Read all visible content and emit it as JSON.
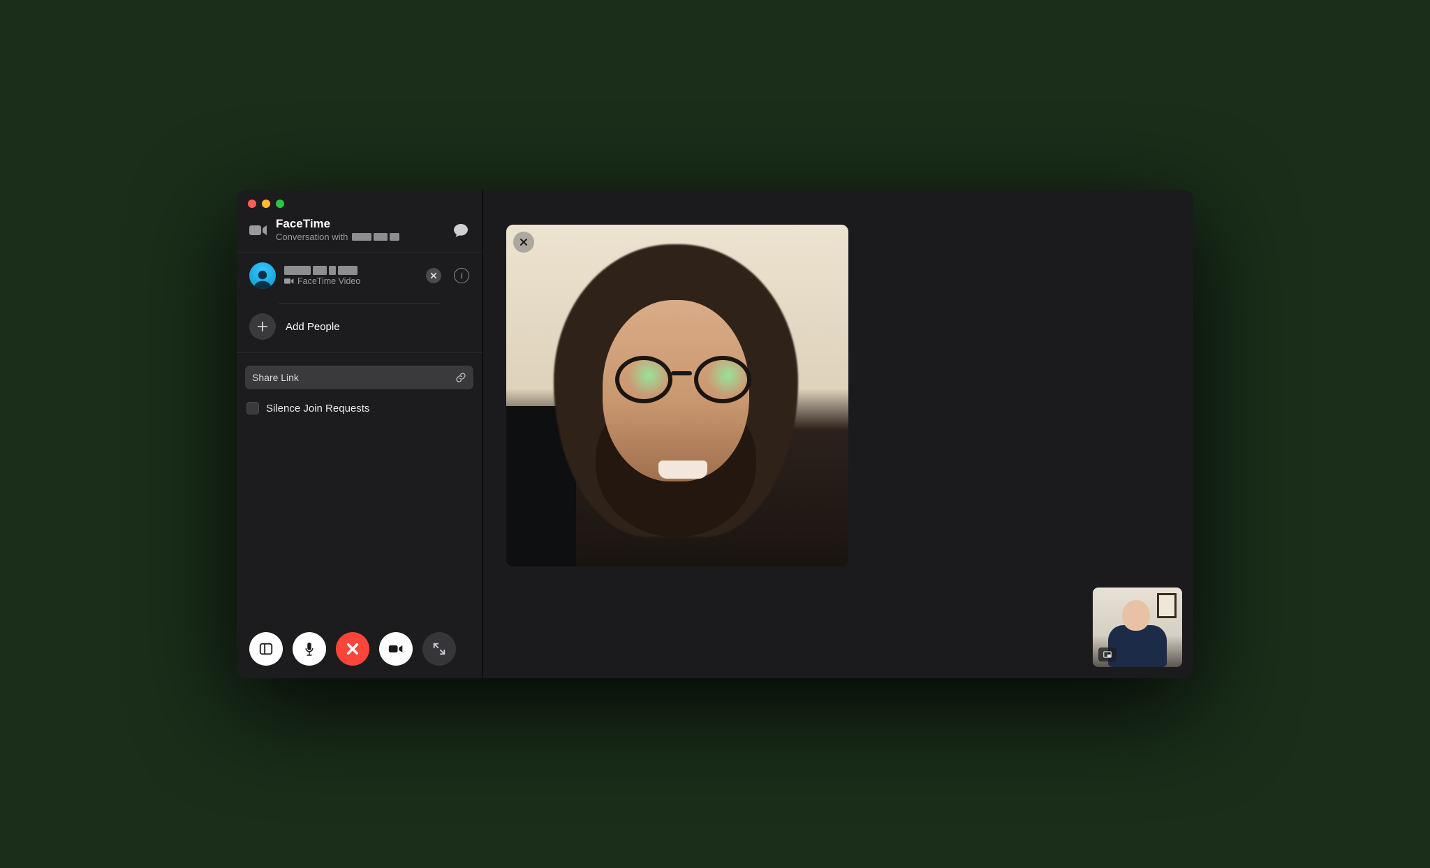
{
  "window": {
    "app_title": "FaceTime",
    "subtitle_prefix": "Conversation with"
  },
  "sidebar": {
    "participant": {
      "sub_label": "FaceTime Video"
    },
    "add_people_label": "Add People",
    "share_link_label": "Share Link",
    "silence_label": "Silence Join Requests"
  },
  "info_glyph": "i"
}
